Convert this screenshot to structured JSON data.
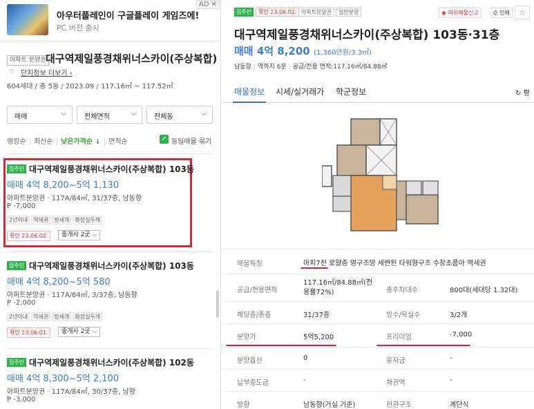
{
  "ad": {
    "title": "아우터플레인이 구글플레이 게임즈에!",
    "subtitle": "PC 버전 출시",
    "badge": "AD ✕"
  },
  "complex": {
    "tag": "아파트 분양권",
    "name": "대구역제일풍경채위너스카이(주상복합)",
    "link": "단지정보 더보기 ›",
    "meta": "604세대 / 총 5동 / 2023.09 / 117.16㎡ ~ 117.52㎡"
  },
  "filters": {
    "trade": "매매",
    "area": "전체면적",
    "dong": "전체동"
  },
  "sort": {
    "ranking": "랭킹순",
    "newest": "최신순",
    "lowest": "낮은가격순 ↓",
    "area": "면적순",
    "same_listing": "동일매물 묶기"
  },
  "listings": [
    {
      "badge": "집주인",
      "title": "대구역제일풍경채위너스카이(주상복합) 103동",
      "price": "매매 4억 8,200~5억 1,130",
      "info": "아파트분양권 · 117A/84㎡, 31/37층, 남동향",
      "premium": "P -7,000",
      "tags": [
        "2년이내",
        "역세권",
        "방세개",
        "화장실두개"
      ],
      "confirm": "확인 23.06.02.",
      "broker": "중개사 2곳 ⌵"
    },
    {
      "badge": "집주인",
      "title": "대구역제일풍경채위너스카이(주상복합) 103동",
      "price": "매매 4억 8,200~5억 580",
      "info": "아파트분양권 · 117A/84㎡, 3/37층, 남동향",
      "premium": "P -2,000",
      "tags": [
        "2년이내",
        "역세권",
        "방세개",
        "화장실두개"
      ],
      "confirm": "확인 23.06.01.",
      "broker": "중개사 2곳 ⌵"
    },
    {
      "badge": "집주인",
      "title": "대구역제일풍경채위너스카이(주상복합) 102동",
      "price": "매매 4억 8,300~5억 2,100",
      "info": "아파트분양권 · 117A/84㎡, 30/37층, 남향",
      "premium": "P -3,000"
    }
  ],
  "detail": {
    "badge_owner": "집주인",
    "badge_confirm": "확인 23.06.02.",
    "badge_type1": "아파트분양권",
    "badge_type2": "일반분양",
    "report": "허위매물신고",
    "print": "인쇄",
    "star": "☆",
    "title": "대구역제일풍경채위너스카이(주상복합) 103동·31층",
    "price": "매매 4억 8,200",
    "price_per": "(1,360만원/3.3㎡)",
    "meta": [
      "남동향",
      "역까지 6분",
      "공급/전용 면적:117.16㎡/84.88㎡"
    ],
    "tabs": [
      "매물정보",
      "시세/실거래가",
      "학군정보"
    ],
    "refresh": "↻ 평",
    "rows": [
      {
        "h1": "매물특징",
        "v1": "마피7천 로얄층 영구조망 세련된 타워형구조 수창초품아 역세권"
      },
      {
        "h1": "공급/전용면적",
        "v1": "117.16㎡/84.88㎡(전용률72%)",
        "h2": "총주차대수",
        "v2": "800대(세대당 1.32대)"
      },
      {
        "h1": "해당층/총층",
        "v1": "31/37층",
        "h2": "방수/욕실수",
        "v2": "3/2개"
      },
      {
        "h1": "분양가",
        "v1": "5억5,200",
        "h2": "프리미엄",
        "v2": "-7,000"
      },
      {
        "h1": "분양옵션",
        "v1": "0",
        "h2": "융자금",
        "v2": "-"
      },
      {
        "h1": "납부중도금",
        "v1": "-",
        "h2": "채권액",
        "v2": "-"
      },
      {
        "h1": "방향",
        "v1": "남동향(거실 기준)",
        "h2": "현관구조",
        "v2": "계단식"
      }
    ]
  },
  "colors": {
    "accent_blue": "#3d7bd9",
    "green": "#2eb34a",
    "red": "#e1222f"
  }
}
